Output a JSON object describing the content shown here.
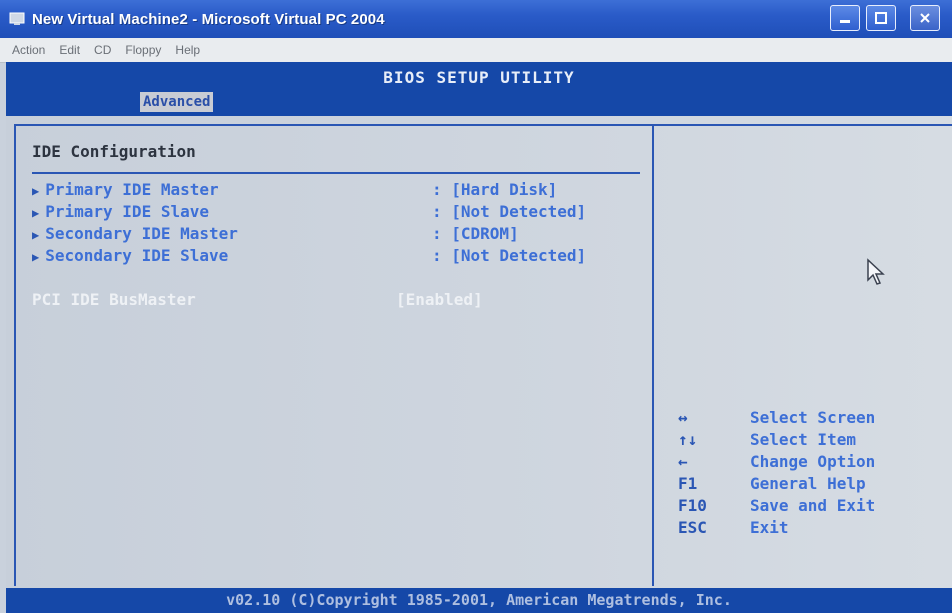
{
  "window": {
    "title": "New Virtual Machine2 - Microsoft Virtual PC 2004",
    "app_icon": "vpc-icon",
    "controls": {
      "minimize": "minimize-icon",
      "maximize": "maximize-icon",
      "close": "close-icon"
    }
  },
  "menubar": {
    "items": [
      "Action",
      "Edit",
      "CD",
      "Floppy",
      "Help"
    ]
  },
  "bios": {
    "title": "BIOS SETUP UTILITY",
    "active_tab": "Advanced"
  },
  "section": {
    "title": "IDE Configuration",
    "items": [
      {
        "label": "Primary IDE Master",
        "value": ": [Hard Disk]"
      },
      {
        "label": "Primary IDE Slave",
        "value": ": [Not Detected]"
      },
      {
        "label": "Secondary IDE Master",
        "value": ": [CDROM]"
      },
      {
        "label": "Secondary IDE Slave",
        "value": ": [Not Detected]"
      }
    ],
    "pci": {
      "label": "PCI IDE BusMaster",
      "value": "[Enabled]"
    }
  },
  "help": [
    {
      "key": "↔",
      "desc": "Select Screen"
    },
    {
      "key": "↑↓",
      "desc": "Select Item"
    },
    {
      "key": "←",
      "desc": "Change Option"
    },
    {
      "key": "F1",
      "desc": "General Help"
    },
    {
      "key": "F10",
      "desc": "Save and Exit"
    },
    {
      "key": "ESC",
      "desc": "Exit"
    }
  ],
  "footer": "v02.10 (C)Copyright 1985-2001, American Megatrends, Inc.",
  "colors": {
    "bios_blue": "#1548a8",
    "accent_text": "#3d6fd6",
    "panel_bg": "#c9d1dc"
  }
}
